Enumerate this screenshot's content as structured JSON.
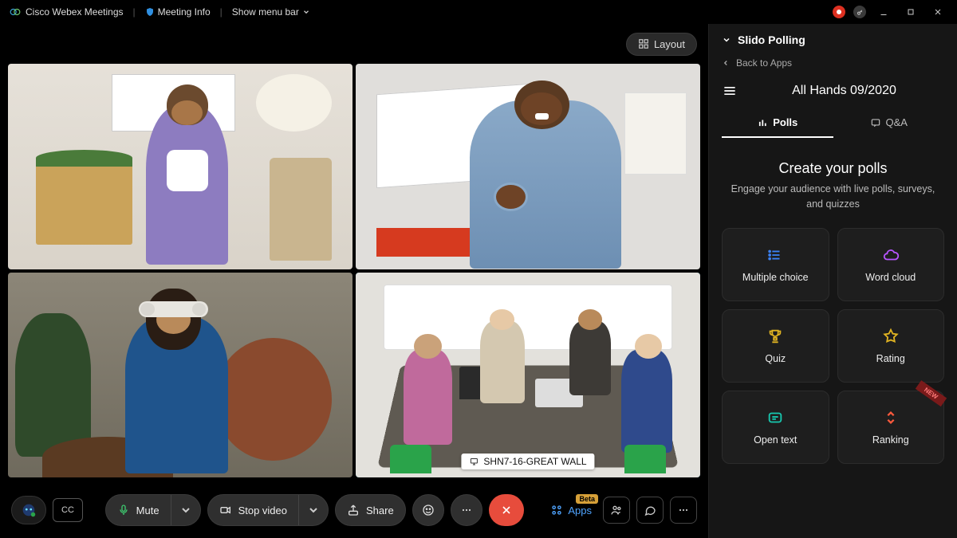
{
  "titlebar": {
    "app_name": "Cisco Webex Meetings",
    "meeting_info_label": "Meeting Info",
    "show_menu_label": "Show menu bar"
  },
  "layout_button": "Layout",
  "tiles": {
    "active_room_label": "SHN7-16-GREAT WALL"
  },
  "controls": {
    "mute": "Mute",
    "stop_video": "Stop video",
    "share": "Share",
    "cc": "CC",
    "apps": "Apps",
    "apps_badge": "Beta"
  },
  "panel": {
    "title": "Slido Polling",
    "back": "Back to Apps",
    "event_name": "All Hands 09/2020",
    "tab_polls": "Polls",
    "tab_qa": "Q&A",
    "heading": "Create your polls",
    "subheading": "Engage your audience with live polls, surveys, and quizzes",
    "types": {
      "multiple_choice": "Multiple choice",
      "word_cloud": "Word cloud",
      "quiz": "Quiz",
      "rating": "Rating",
      "open_text": "Open text",
      "ranking": "Ranking",
      "new_tag": "NEW"
    }
  }
}
